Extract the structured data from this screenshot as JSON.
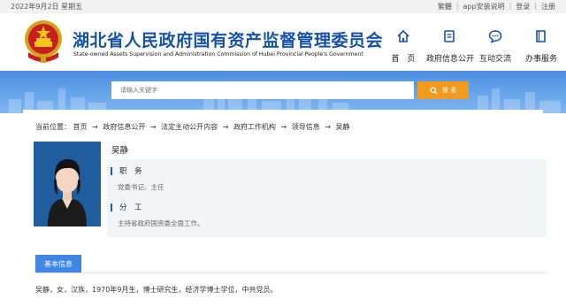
{
  "topbar": {
    "date": "2022年9月2日 星期五",
    "links": [
      "繁體",
      "app安装说明",
      "登录",
      "注册"
    ]
  },
  "header": {
    "title": "湖北省人民政府国有资产监督管理委员会",
    "subtitle": "State-owned Assets Supervision and Administration Commission of Hubei Provincial People's Government",
    "nav": [
      {
        "label": "首　页",
        "icon": "home-icon"
      },
      {
        "label": "政府信息公开",
        "icon": "document-icon"
      },
      {
        "label": "互动交流",
        "icon": "chat-icon"
      },
      {
        "label": "办事服务",
        "icon": "book-icon"
      }
    ],
    "accent_color": "#1552a8"
  },
  "search": {
    "placeholder": "请输入关键字",
    "button_label": "搜 索",
    "button_color": "#f29a1d"
  },
  "breadcrumb": {
    "prefix": "当前位置：",
    "items": [
      "首页",
      "政府信息公开",
      "法定主动公开内容",
      "政府工作机构",
      "领导信息",
      "吴静"
    ]
  },
  "profile": {
    "name": "吴静",
    "duty_label": "职　务",
    "duty_value": "党委书记、主任",
    "division_label": "分　工",
    "division_value": "主持省政府国资委全面工作。"
  },
  "tabs": {
    "active": "基本信息"
  },
  "bio": "吴静，女，汉族，1970年9月生，博士研究生，经济学博士学位，中共党员。"
}
